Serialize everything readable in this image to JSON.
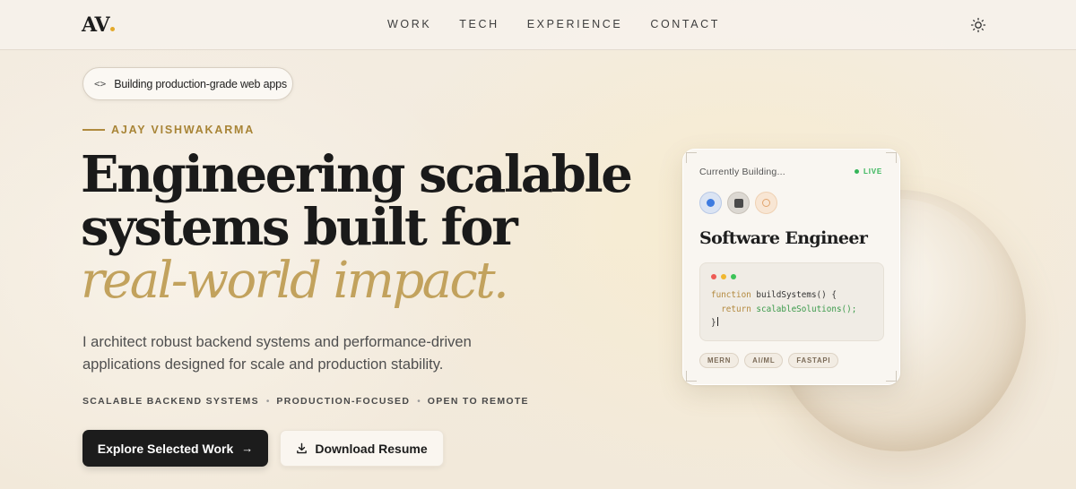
{
  "nav": {
    "logo_text": "AV",
    "links": [
      {
        "label": "WORK"
      },
      {
        "label": "TECH"
      },
      {
        "label": "EXPERIENCE"
      },
      {
        "label": "CONTACT"
      }
    ],
    "theme_icon": "sun-icon"
  },
  "hero": {
    "badge_icon": "code-brackets-icon",
    "badge_text": "Building production-grade web apps",
    "eyebrow": "AJAY VISHWAKARMA",
    "headline_line1": "Engineering scalable",
    "headline_line2": "systems built for",
    "headline_accent": "real-world impact.",
    "lead": "I architect robust backend systems and performance-driven applications designed for scale and production stability.",
    "tags": [
      "SCALABLE BACKEND SYSTEMS",
      "PRODUCTION-FOCUSED",
      "OPEN TO REMOTE"
    ],
    "primary_button": "Explore Selected Work",
    "primary_button_icon": "arrow-right-icon",
    "secondary_button": "Download Resume",
    "secondary_button_icon": "download-icon"
  },
  "card": {
    "status_label": "Currently Building...",
    "live_label": "LIVE",
    "role": "Software Engineer",
    "code": {
      "line1_kw": "function",
      "line1_rest": " buildSystems() {",
      "line2_kw": "return",
      "line2_rest": "scalableSolutions();",
      "line3": "}"
    },
    "chips": [
      "MERN",
      "AI/ML",
      "FASTAPI"
    ]
  },
  "colors": {
    "accent_gold": "#c2a25d",
    "live_green": "#35b559",
    "primary_button_bg": "#1c1c1c",
    "background": "#f4ede2"
  }
}
